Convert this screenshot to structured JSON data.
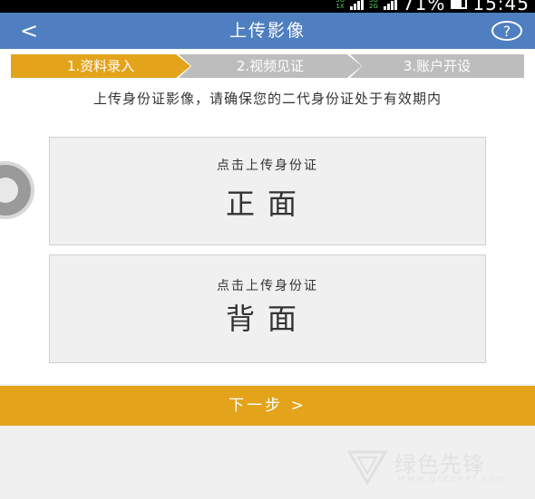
{
  "status_bar": {
    "network_top": "3G",
    "network_bottom": "1X",
    "network2_top": "3G",
    "network2_bottom": "2G",
    "battery_percent": "71%",
    "time": "15:45"
  },
  "header": {
    "back_glyph": "<",
    "title": "上传影像",
    "help_glyph": "?"
  },
  "steps": [
    {
      "label": "1.资料录入",
      "active": true
    },
    {
      "label": "2.视频见证",
      "active": false
    },
    {
      "label": "3.账户开设",
      "active": false
    }
  ],
  "notice": "上传身份证影像，请确保您的二代身份证处于有效期内",
  "upload_cards": [
    {
      "hint": "点击上传身份证",
      "face": "正面"
    },
    {
      "hint": "点击上传身份证",
      "face": "背面"
    }
  ],
  "next_button": "下一步 >",
  "watermark": {
    "text": "绿色先锋",
    "url": "www.greenxf.com"
  },
  "colors": {
    "header_bg": "#4f7fc0",
    "accent": "#e3a41c",
    "inactive_step": "#bdbdbd"
  }
}
